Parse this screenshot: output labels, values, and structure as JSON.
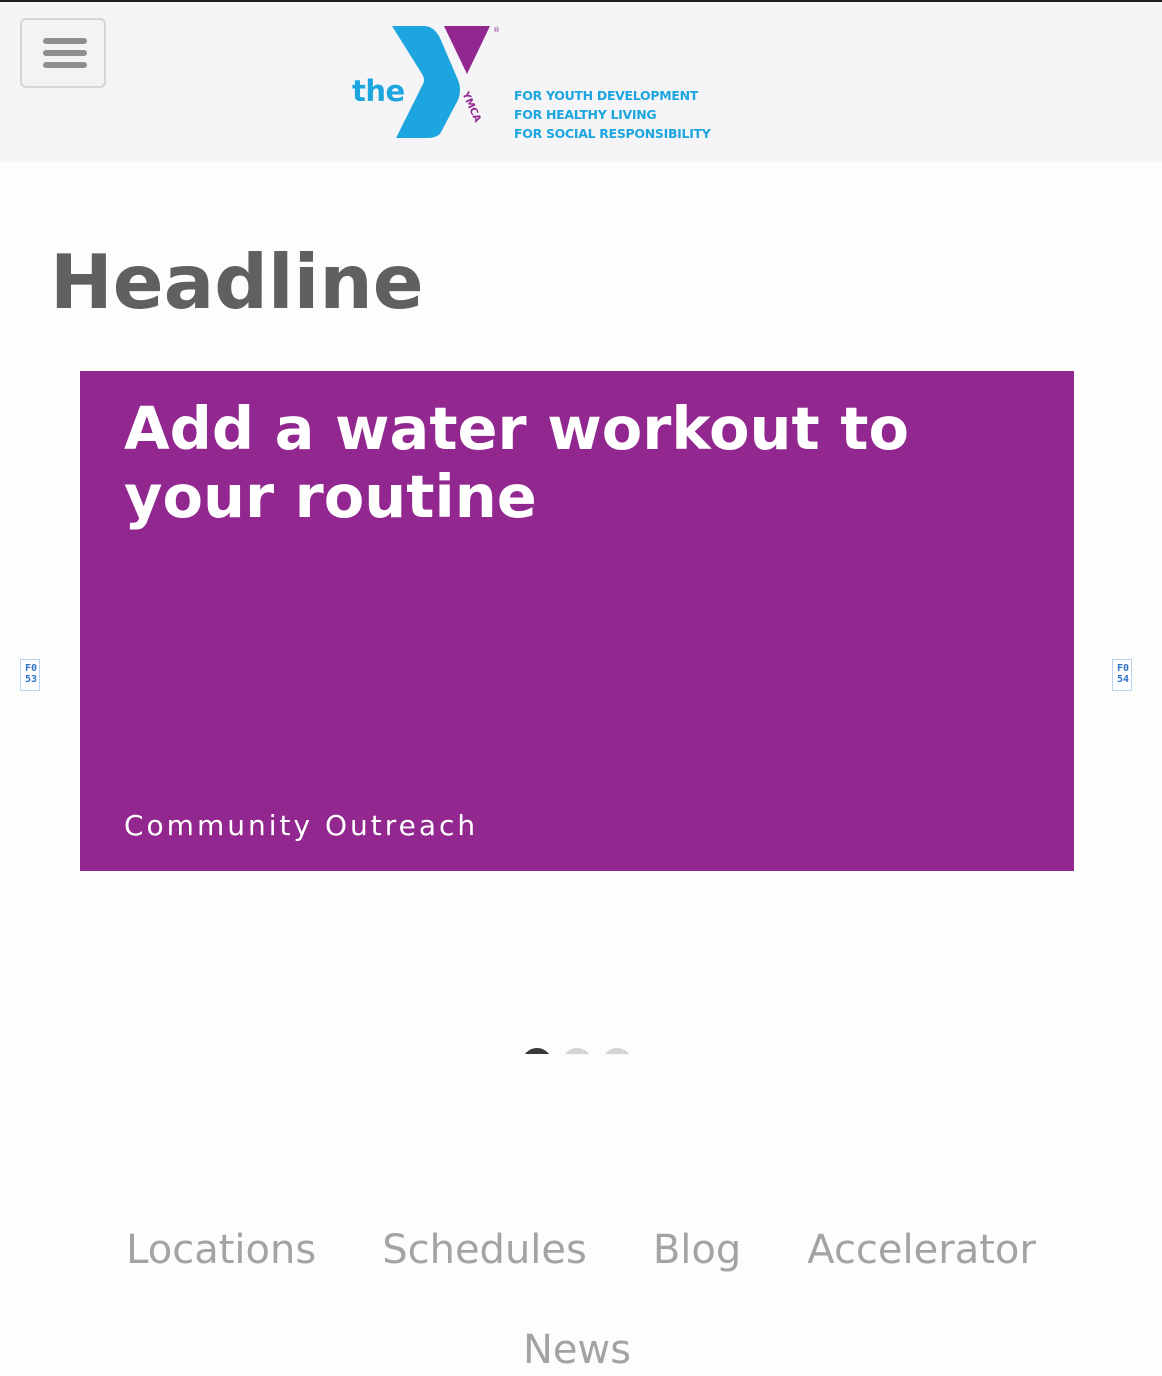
{
  "header": {
    "menu_button_icon": "hamburger-menu-icon",
    "logo": {
      "the_text": "the",
      "ymca_text": "YMCA",
      "registered_mark": "®",
      "tagline": [
        "FOR YOUTH DEVELOPMENT",
        "FOR HEALTHY LIVING",
        "FOR SOCIAL RESPONSIBILITY"
      ],
      "colors": {
        "cyan": "#1ca5df",
        "purple": "#92278f"
      }
    }
  },
  "main": {
    "headline": "Headline",
    "carousel": {
      "prev_icon_text": "F053",
      "next_icon_text": "F054",
      "prev_icon": "chevron-left-icon",
      "next_icon": "chevron-right-icon",
      "slide": {
        "title": "Add a water workout to your routine",
        "category": "Community Outreach",
        "background": "#92278f"
      },
      "dots": [
        {
          "active": true
        },
        {
          "active": false
        },
        {
          "active": false
        }
      ]
    }
  },
  "footer": {
    "nav": [
      {
        "label": "Locations"
      },
      {
        "label": "Schedules"
      },
      {
        "label": "Blog"
      },
      {
        "label": "Accelerator"
      },
      {
        "label": "News"
      }
    ]
  }
}
